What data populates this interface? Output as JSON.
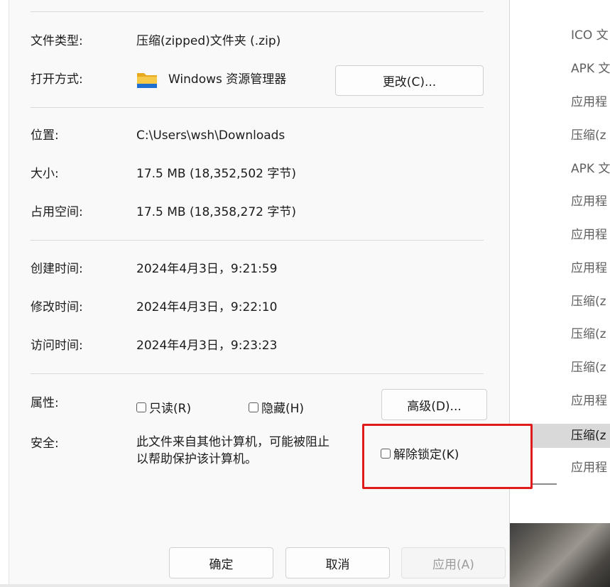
{
  "explorer_list": {
    "items": [
      {
        "label": "ICO 文"
      },
      {
        "label": "APK 文"
      },
      {
        "label": "应用程"
      },
      {
        "label": "压缩(z"
      },
      {
        "label": "APK 文"
      },
      {
        "label": "应用程"
      },
      {
        "label": "应用程"
      },
      {
        "label": "应用程"
      },
      {
        "label": "压缩(z"
      },
      {
        "label": "压缩(z"
      },
      {
        "label": "压缩(z"
      },
      {
        "label": "应用程"
      },
      {
        "label": "压缩(z"
      },
      {
        "label": "应用程"
      }
    ],
    "selected_index": 12
  },
  "properties": {
    "file_type": {
      "label": "文件类型:",
      "value": "压缩(zipped)文件夹 (.zip)"
    },
    "opens_with": {
      "label": "打开方式:",
      "value": "Windows 资源管理器",
      "icon": "folder-icon",
      "change_button": "更改(C)..."
    },
    "location": {
      "label": "位置:",
      "value": "C:\\Users\\wsh\\Downloads"
    },
    "size": {
      "label": "大小:",
      "value": "17.5 MB (18,352,502 字节)"
    },
    "size_on_disk": {
      "label": "占用空间:",
      "value": "17.5 MB (18,358,272 字节)"
    },
    "created": {
      "label": "创建时间:",
      "value": "2024年4月3日，9:21:59"
    },
    "modified": {
      "label": "修改时间:",
      "value": "2024年4月3日，9:22:10"
    },
    "accessed": {
      "label": "访问时间:",
      "value": "2024年4月3日，9:23:23"
    },
    "attributes": {
      "label": "属性:",
      "readonly": {
        "label": "只读(R)",
        "checked": false
      },
      "hidden": {
        "label": "隐藏(H)",
        "checked": false
      },
      "advanced_button": "高级(D)..."
    },
    "security": {
      "label": "安全:",
      "text": "此文件来自其他计算机，可能被阻止\n以帮助保护该计算机。",
      "unblock": {
        "label": "解除锁定(K)",
        "checked": false
      }
    }
  },
  "footer": {
    "ok": "确定",
    "cancel": "取消",
    "apply": "应用(A)"
  },
  "colors": {
    "highlight": "#e01b1b",
    "folder_yellow": "#f4c430",
    "folder_blue": "#1f6fd1"
  }
}
